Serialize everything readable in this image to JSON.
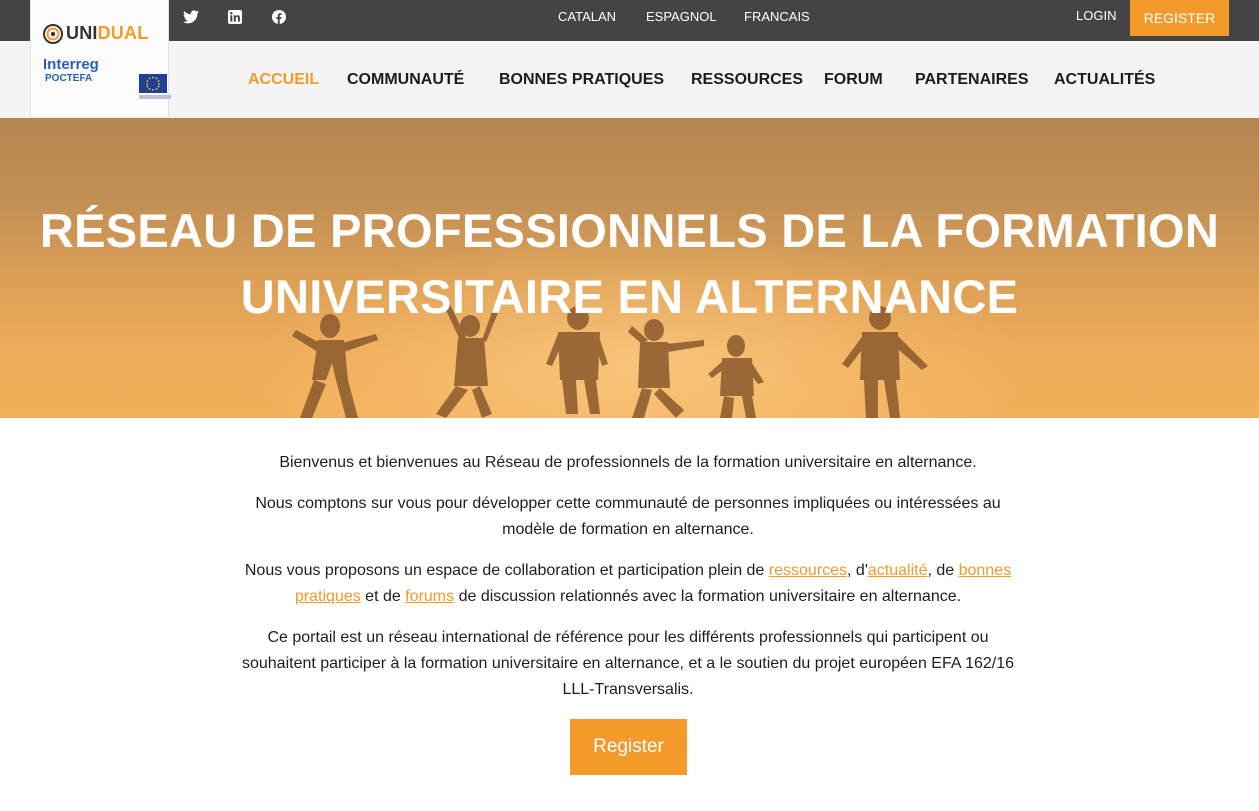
{
  "topbar": {
    "social": [
      "twitter-icon",
      "linkedin-icon",
      "facebook-icon"
    ],
    "languages": [
      "CATALAN",
      "ESPAGNOL",
      "FRANCAIS"
    ],
    "login_label": "LOGIN",
    "register_label": "REGISTER"
  },
  "logo": {
    "unidual_part1": "UNI",
    "unidual_part2": "DUAL",
    "interreg_name": "Interreg",
    "interreg_sub": "POCTEFA"
  },
  "nav": {
    "items": [
      "ACCUEIL",
      "COMMUNAUTÉ",
      "BONNES PRATIQUES",
      "RESSOURCES",
      "FORUM",
      "PARTENAIRES",
      "ACTUALITÉS"
    ],
    "active": "ACCUEIL"
  },
  "hero": {
    "title_line1": "RÉSEAU DE PROFESSIONNELS DE LA FORMATION",
    "title_line2": "UNIVERSITAIRE EN ALTERNANCE"
  },
  "content": {
    "p1": "Bienvenus et bienvenues au Réseau de professionnels de la formation universitaire en alternance.",
    "p2": "Nous comptons sur vous pour développer cette communauté de personnes impliquées ou intéressées au modèle de formation en alternance.",
    "p3_part1": "Nous vous proposons un espace de collaboration et participation plein de ",
    "p3_link1": "ressources",
    "p3_part2": ", d'",
    "p3_link2": "actualité",
    "p3_part3": ", de ",
    "p3_link3": "bonnes pratiques",
    "p3_part4": " et de ",
    "p3_link4": "forums",
    "p3_part5": " de discussion relationnés avec la formation universitaire en alternance.",
    "p4": "Ce portail est un réseau international de référence pour les différents professionnels qui participent ou souhaitent participer à la formation universitaire en alternance, et a le soutien du projet européen EFA 162/16 LLL-Transversalis.",
    "register_label": "Register"
  },
  "colors": {
    "accent": "#f39a2a",
    "topbar": "#444444",
    "navbar": "#f4f4f4"
  }
}
